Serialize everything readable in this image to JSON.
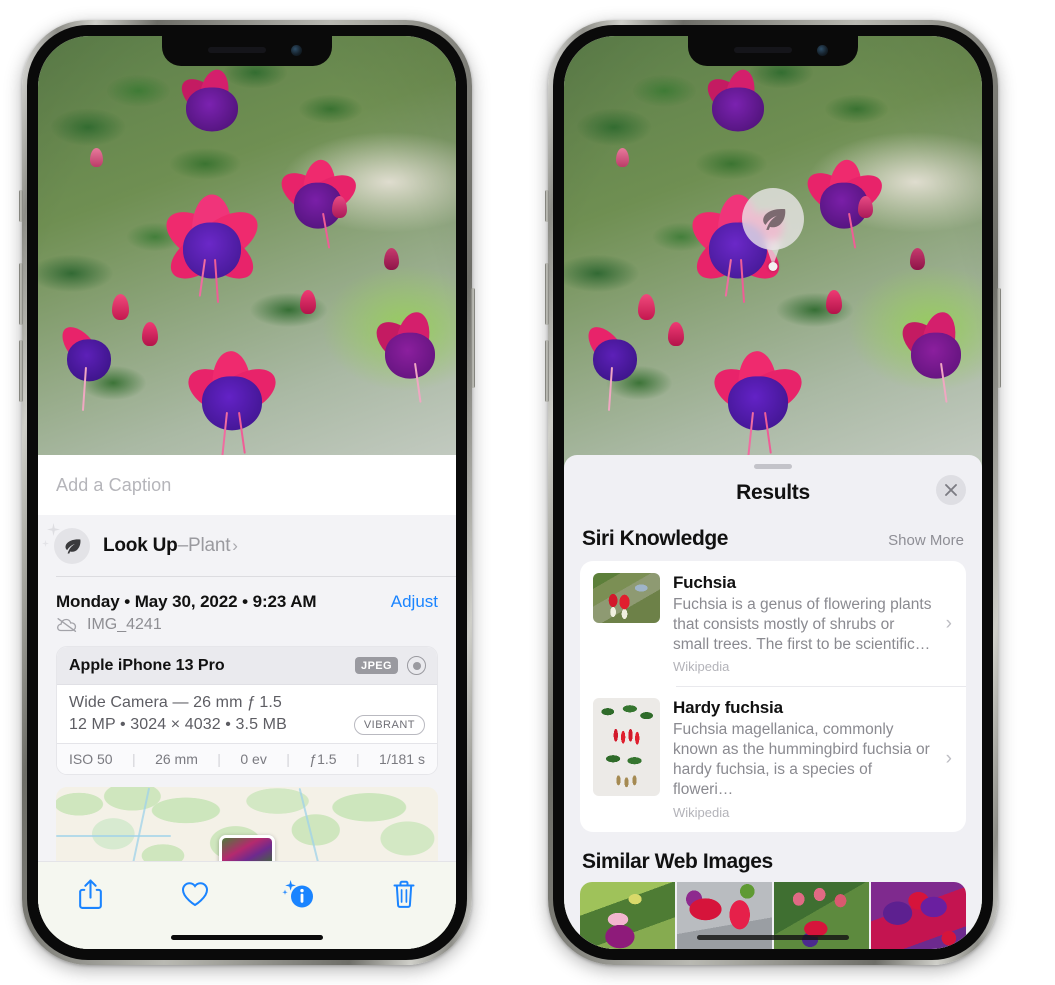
{
  "left_phone": {
    "name": "photo-detail-screen",
    "caption_field": {
      "placeholder": "Add a Caption",
      "value": ""
    },
    "lookup_row": {
      "icon": "leaf-icon",
      "sparkle_icon": "sparkles-icon",
      "label": "Look Up",
      "dash": " – ",
      "subject": "Plant",
      "chevron": "›"
    },
    "meta": {
      "date": "Monday • May 30, 2022 • 9:23 AM",
      "adjust_label": "Adjust",
      "cloud_icon": "cloud-slash-icon",
      "filename": "IMG_4241"
    },
    "camera_card": {
      "device": "Apple iPhone 13 Pro",
      "format_tag": "JPEG",
      "raw_icon": "aperture-icon",
      "lens_line": "Wide Camera — 26 mm ƒ 1.5",
      "specs_line": "12 MP  •  3024 × 4032  •  3.5 MB",
      "style_pill": "VIBRANT",
      "exif": [
        "ISO 50",
        "26 mm",
        "0 ev",
        "ƒ1.5",
        "1/181 s"
      ]
    },
    "map": {
      "name": "location-map",
      "pin": "photo-pin"
    },
    "toolbar": [
      {
        "name": "share-button",
        "icon": "share-icon"
      },
      {
        "name": "favorite-button",
        "icon": "heart-icon"
      },
      {
        "name": "info-button",
        "icon": "info-sparkle-icon"
      },
      {
        "name": "delete-button",
        "icon": "trash-icon"
      }
    ],
    "accent_color": "#1a84ff"
  },
  "right_phone": {
    "name": "visual-lookup-results-screen",
    "photo_badge": {
      "icon": "leaf-icon",
      "label": "plant-detected-badge"
    },
    "sheet": {
      "grabber": "drag-handle",
      "title": "Results",
      "close_icon": "close-icon"
    },
    "siri_knowledge": {
      "heading": "Siri Knowledge",
      "action": "Show More",
      "entries": [
        {
          "title": "Fuchsia",
          "description": "Fuchsia is a genus of flowering plants that consists mostly of shrubs or small trees. The first to be scientific…",
          "source": "Wikipedia",
          "thumb": "fuchsia-red-flowers-thumb",
          "chevron": "›"
        },
        {
          "title": "Hardy fuchsia",
          "description": "Fuchsia magellanica, commonly known as the hummingbird fuchsia or hardy fuchsia, is a species of floweri…",
          "source": "Wikipedia",
          "thumb": "hardy-fuchsia-specimen-thumb",
          "chevron": "›"
        }
      ]
    },
    "similar_web_images": {
      "heading": "Similar Web Images",
      "items": [
        "fuchsia-pink-purple-bloom",
        "fuchsia-red-closeup",
        "fuchsia-bush-buds",
        "fuchsia-purple-red-cluster"
      ]
    }
  }
}
